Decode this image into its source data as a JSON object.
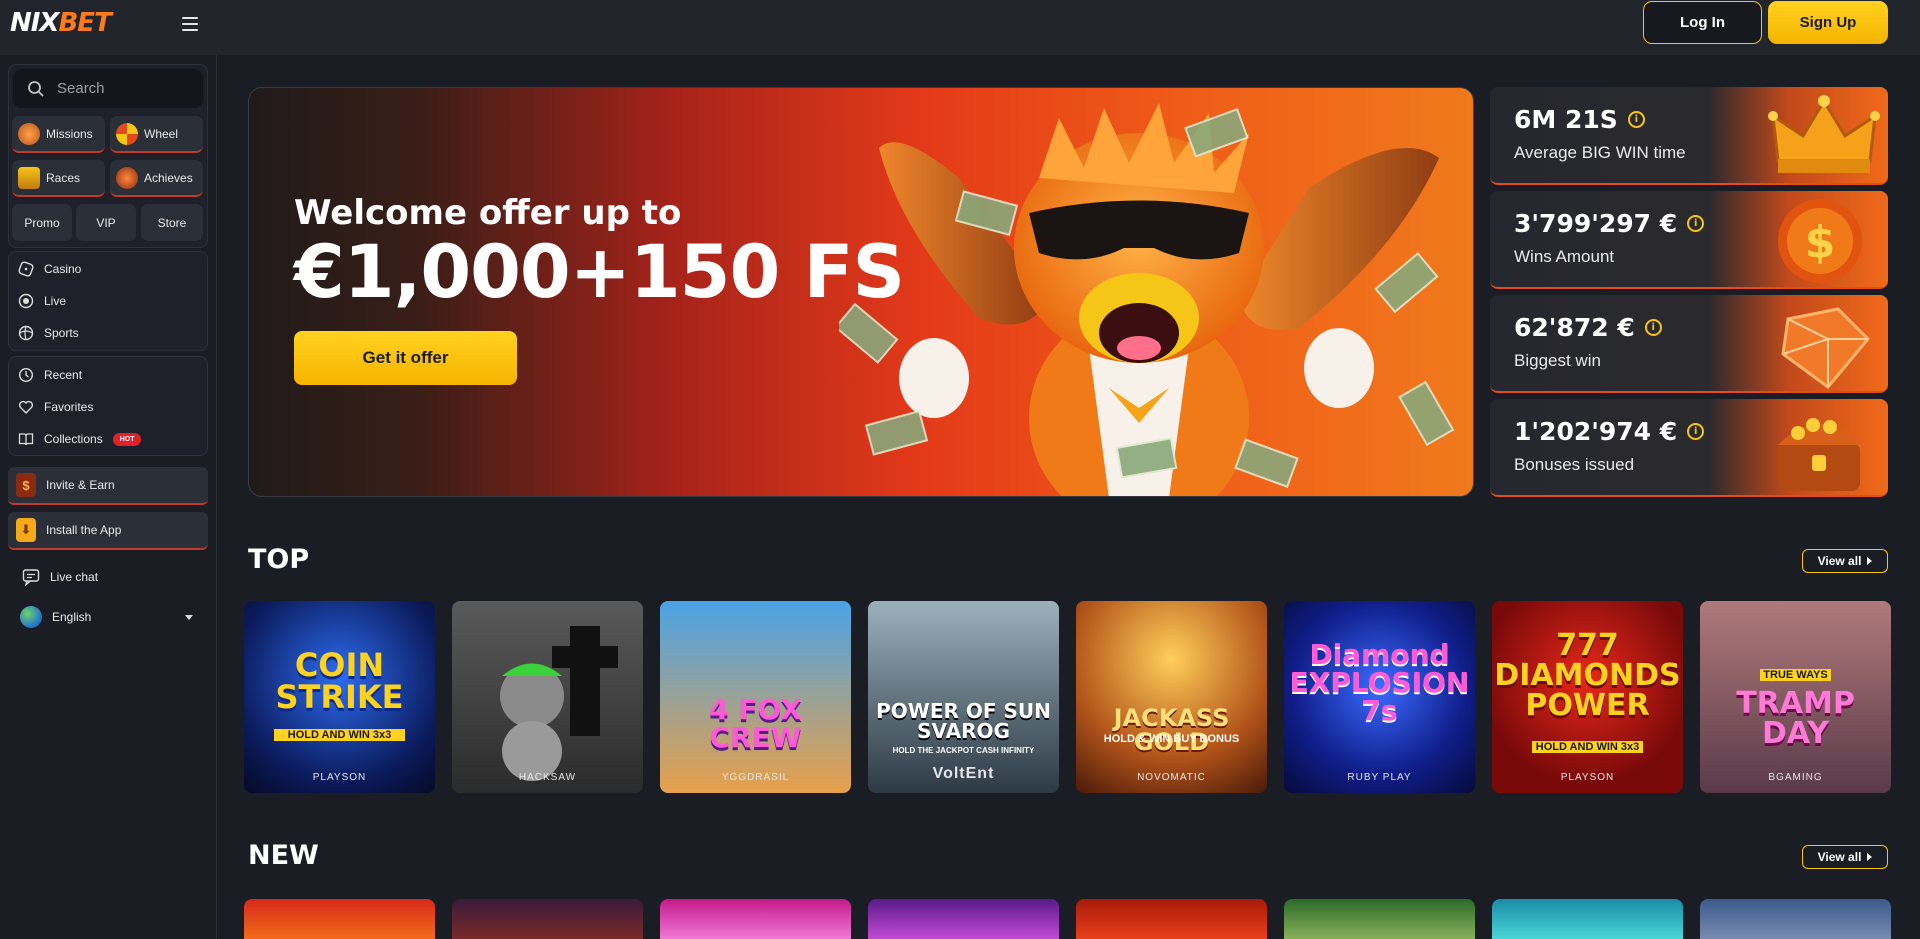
{
  "header": {
    "logo_part1": "NIX",
    "logo_part2": "BET",
    "login_label": "Log In",
    "signup_label": "Sign Up"
  },
  "sidebar": {
    "search_placeholder": "Search",
    "chips": [
      {
        "label": "Missions"
      },
      {
        "label": "Wheel"
      },
      {
        "label": "Races"
      },
      {
        "label": "Achieves"
      },
      {
        "label": "Promo"
      },
      {
        "label": "VIP"
      },
      {
        "label": "Store"
      }
    ],
    "nav_main": [
      {
        "label": "Casino"
      },
      {
        "label": "Live"
      },
      {
        "label": "Sports"
      }
    ],
    "nav_personal": [
      {
        "label": "Recent"
      },
      {
        "label": "Favorites"
      },
      {
        "label": "Collections",
        "badge": "HOT"
      }
    ],
    "invite_label": "Invite & Earn",
    "install_label": "Install the App",
    "livechat_label": "Live chat",
    "language": "English"
  },
  "banner": {
    "title": "Welcome offer up to",
    "amount": "€1,000+150 FS",
    "cta": "Get it offer"
  },
  "stats": [
    {
      "value": "6M 21S",
      "label": "Average BIG WIN time",
      "icon": "crown-icon"
    },
    {
      "value": "3'799'297 €",
      "label": "Wins Amount",
      "icon": "coin-icon"
    },
    {
      "value": "62'872 €",
      "label": "Biggest win",
      "icon": "diamond-icon"
    },
    {
      "value": "1'202'974 €",
      "label": "Bonuses issued",
      "icon": "chest-icon"
    }
  ],
  "sections": {
    "top_title": "TOP",
    "new_title": "NEW",
    "view_all": "View all"
  },
  "top_games": [
    {
      "name": "COIN STRIKE",
      "sub": "HOLD AND WIN 3x3",
      "provider": "PLAYSON"
    },
    {
      "name": "",
      "sub": "",
      "provider": "HACKSAW"
    },
    {
      "name": "4 FOX CREW",
      "sub": "",
      "provider": "YGGDRASIL"
    },
    {
      "name": "POWER OF SUN SVAROG",
      "sub": "HOLD THE JACKPOT CASH INFINITY",
      "provider": "VoltEnt"
    },
    {
      "name": "JACKASS GOLD",
      "sub": "HOLD & WIN BUY BONUS",
      "provider": "NOVOMATIC"
    },
    {
      "name": "Diamond EXPLOSION 7s",
      "sub": "",
      "provider": "RUBY PLAY"
    },
    {
      "name": "777 DIAMONDS POWER",
      "sub": "HOLD AND WIN 3x3",
      "provider": "PLAYSON"
    },
    {
      "name": "TRAMP DAY",
      "sub": "TRUE WAYS",
      "provider": "BGAMING"
    }
  ]
}
